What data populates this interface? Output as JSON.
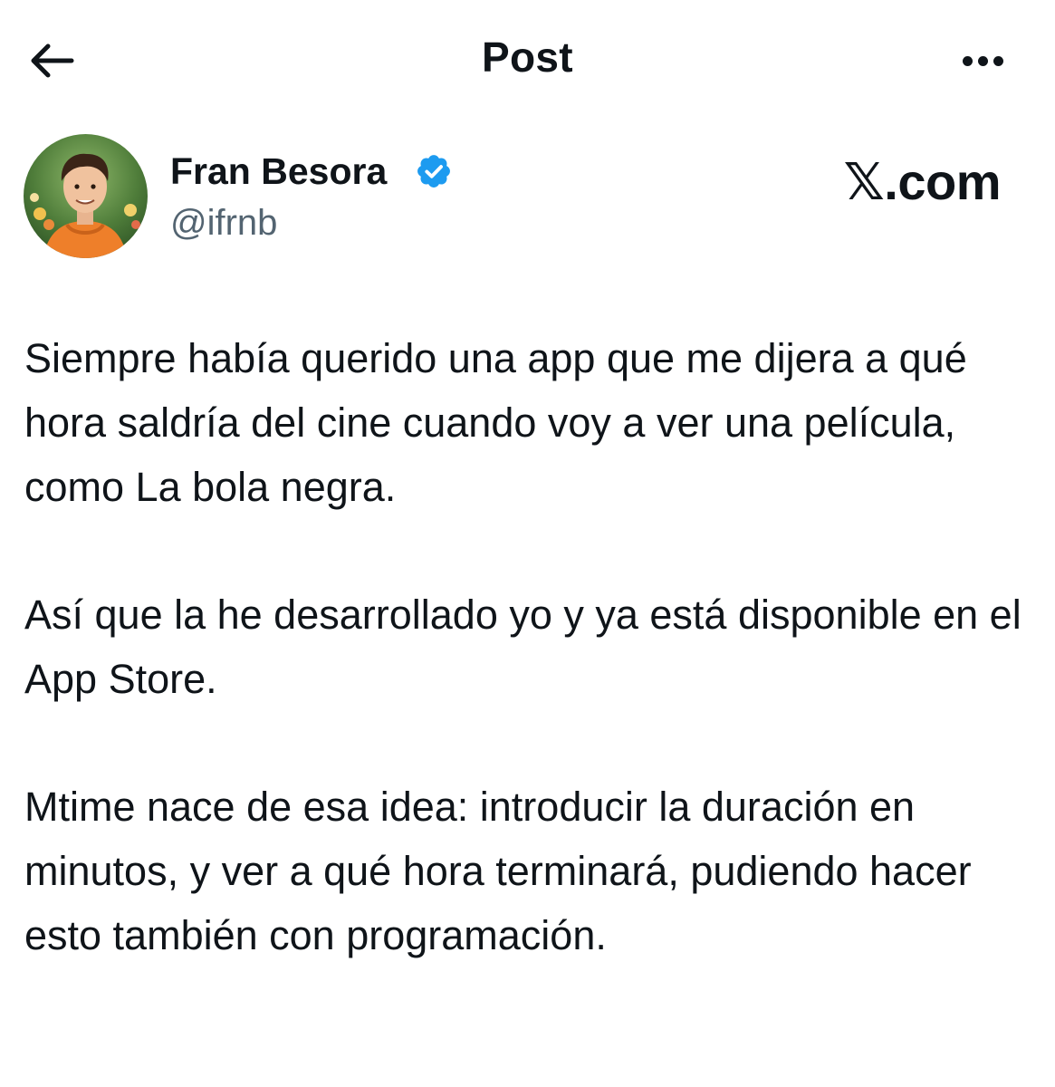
{
  "header": {
    "title": "Post",
    "back_icon": "arrow-left-icon",
    "more_icon": "more-horizontal-icon"
  },
  "author": {
    "name": "Fran Besora",
    "handle": "@ifrnb",
    "verified": true,
    "verified_color": "#1d9bf0"
  },
  "watermark": "𝕏.com",
  "post": {
    "paragraphs": [
      "Siempre había querido una app que me dijera a qué hora saldría del cine cuando voy a ver una película, como La bola negra.",
      "Así que la he desarrollado yo y ya está disponible en el App Store.",
      "Mtime nace de esa idea: introducir la duración en minutos, y ver a qué hora terminará, pudiendo hacer esto también con programación."
    ]
  },
  "colors": {
    "text": "#0f1419",
    "secondary_text": "#536471",
    "background": "#ffffff"
  }
}
